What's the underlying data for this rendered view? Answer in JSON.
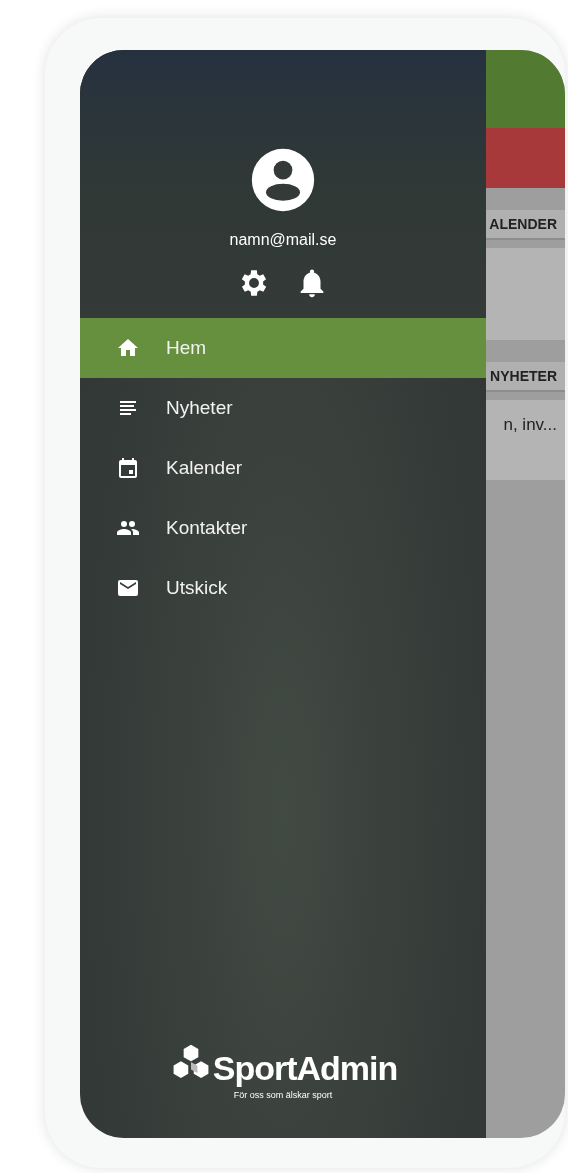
{
  "drawer": {
    "user_email": "namn@mail.se",
    "menu": [
      {
        "label": "Hem",
        "kind": "home",
        "selected": true
      },
      {
        "label": "Nyheter",
        "kind": "news",
        "selected": false
      },
      {
        "label": "Kalender",
        "kind": "calendar",
        "selected": false
      },
      {
        "label": "Kontakter",
        "kind": "contacts",
        "selected": false
      },
      {
        "label": "Utskick",
        "kind": "mail",
        "selected": false
      }
    ],
    "logo": {
      "name": "SportAdmin",
      "tagline": "För oss som älskar sport"
    }
  },
  "background_page": {
    "section_headers": [
      "ALENDER",
      "NYHETER"
    ],
    "news_excerpt": "n, inv..."
  }
}
